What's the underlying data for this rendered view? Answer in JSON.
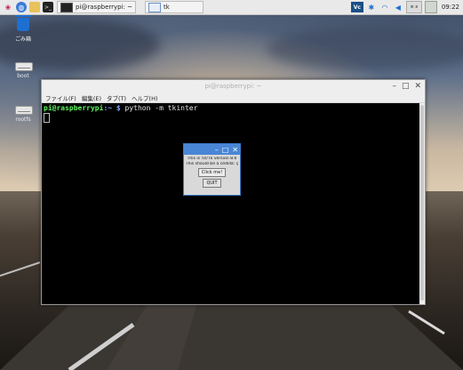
{
  "taskbar": {
    "tasks": [
      {
        "label": "pi@raspberrypi: ~"
      },
      {
        "label": "tk"
      }
    ],
    "clock": "09:22",
    "vnc_label": "Vc",
    "kbd_label": "≡ x"
  },
  "desktop": {
    "icons": [
      {
        "label": "ごみ箱"
      },
      {
        "label": "boot"
      },
      {
        "label": "rootfs"
      }
    ]
  },
  "terminal": {
    "title": "pi@raspberrypi: ~",
    "menu": [
      "ファイル(F)",
      "編集(E)",
      "タブ(T)",
      "ヘルプ(H)"
    ],
    "prompt_user": "pi@raspberrypi",
    "prompt_path": ":~ $ ",
    "command": "python -m tkinter"
  },
  "tk_window": {
    "line1": "This is Tcl/Tk version 8.6",
    "line2": "This should be a cedilla: ç",
    "click_label": "Click me!",
    "quit_label": "QUIT"
  },
  "colors": {
    "terminal_user": "#5ff35f",
    "terminal_path": "#7aa6ff",
    "tk_titlebar": "#4a86d6",
    "trash_blue": "#1f6fd0"
  }
}
